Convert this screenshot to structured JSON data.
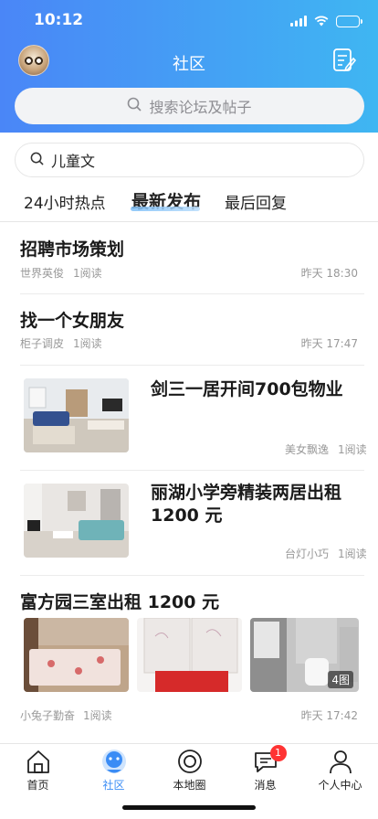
{
  "status_bar": {
    "time": "10:12"
  },
  "header": {
    "title": "社区"
  },
  "search": {
    "placeholder": "搜索论坛及帖子"
  },
  "search_history": {
    "term": "儿童文"
  },
  "tabs": [
    {
      "label": "24小时热点"
    },
    {
      "label": "最新发布"
    },
    {
      "label": "最后回复"
    }
  ],
  "posts": [
    {
      "title": "招聘市场策划",
      "author": "世界英俊",
      "reads": "1阅读",
      "time": "昨天 18:30"
    },
    {
      "title": "找一个女朋友",
      "author": "柜子调皮",
      "reads": "1阅读",
      "time": "昨天 17:47"
    },
    {
      "title": "剑三一居开间700包物业",
      "author": "美女飘逸",
      "reads": "1阅读"
    },
    {
      "title": "丽湖小学旁精装两居出租 1200 元",
      "author": "台灯小巧",
      "reads": "1阅读"
    },
    {
      "title": "富方园三室出租 1200 元",
      "author": "小兔子勤奋",
      "reads": "1阅读",
      "time": "昨天 17:42",
      "image_count": "4图"
    }
  ],
  "tabbar": {
    "items": [
      {
        "label": "首页",
        "icon": "home-icon"
      },
      {
        "label": "社区",
        "icon": "community-icon",
        "active": true
      },
      {
        "label": "本地圈",
        "icon": "local-circle-icon"
      },
      {
        "label": "消息",
        "icon": "message-icon",
        "badge": "1"
      },
      {
        "label": "个人中心",
        "icon": "profile-icon"
      }
    ]
  },
  "colors": {
    "accent": "#3a8cf5",
    "header_start": "#4a86f7",
    "header_end": "#3fb6f2",
    "badge": "#ff3333"
  }
}
